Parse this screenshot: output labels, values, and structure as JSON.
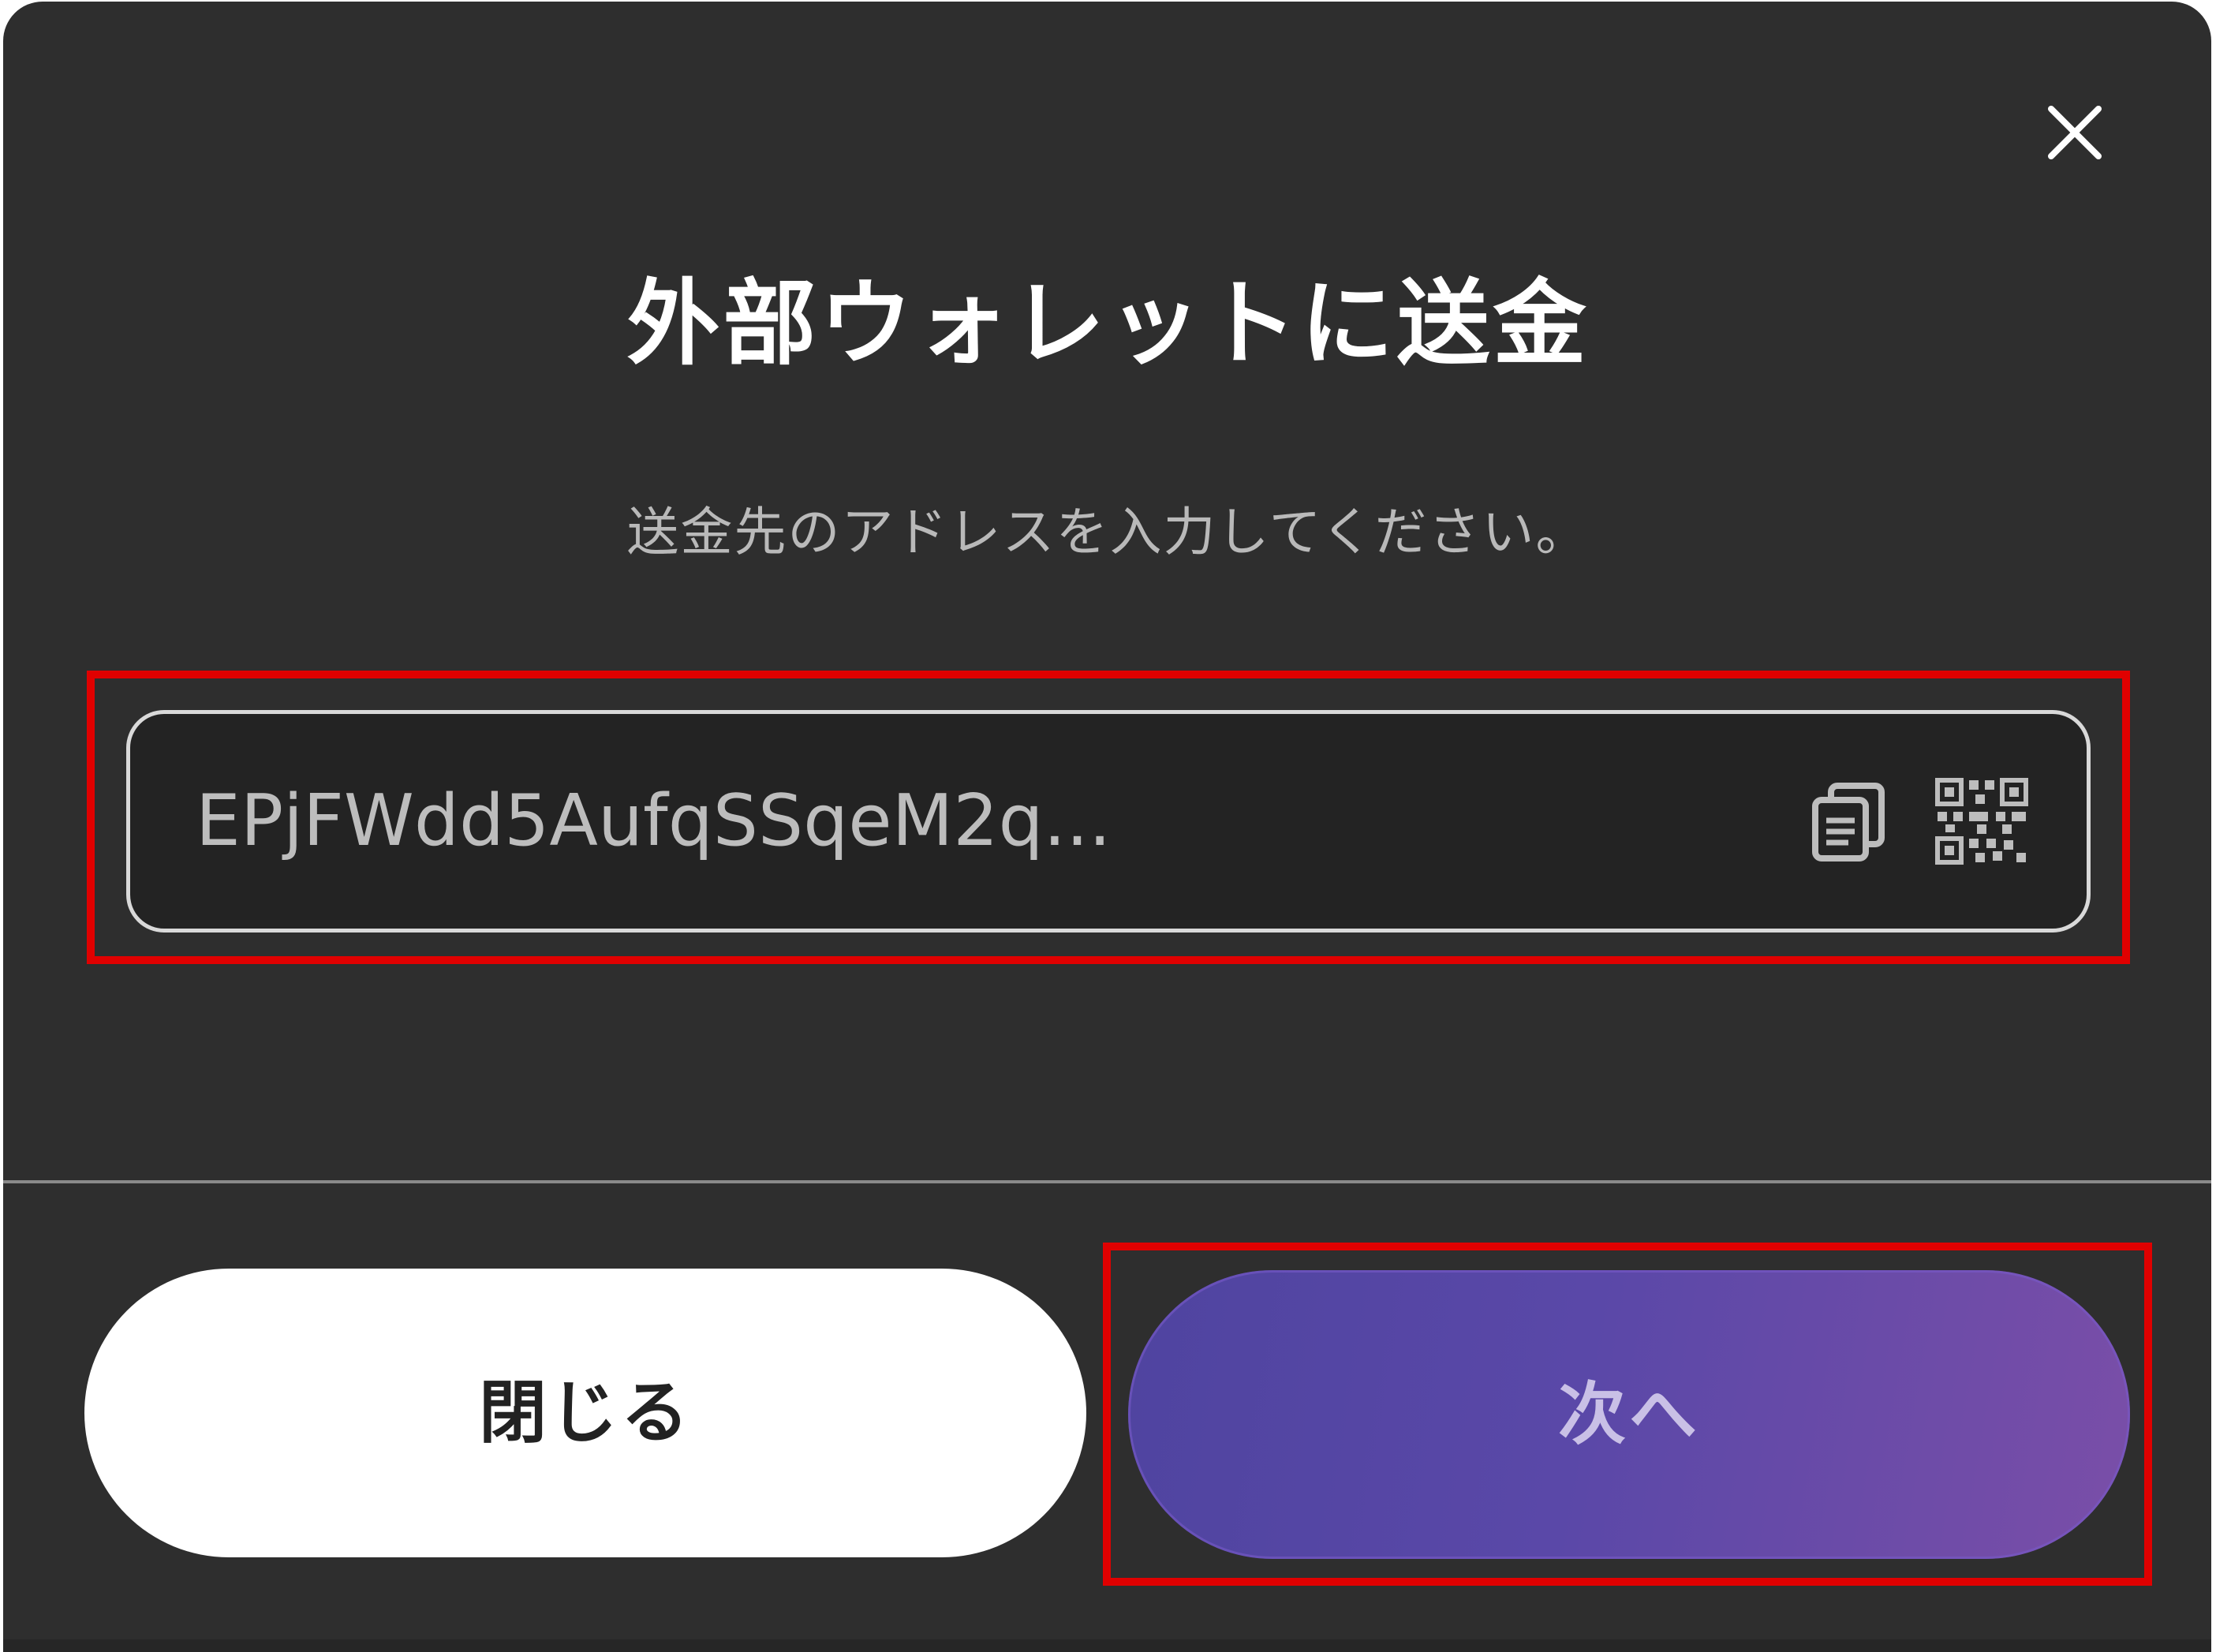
{
  "dialog": {
    "title": "外部ウォレットに送金",
    "instruction": "送金先のアドレスを入力してください。"
  },
  "address_field": {
    "value": "EPjFWdd5AufqSSqeM2q...",
    "paste_icon": "paste-icon",
    "qr_icon": "qr-code-icon"
  },
  "buttons": {
    "close_label": "閉じる",
    "next_label": "次へ"
  },
  "icons": {
    "close": "close-icon"
  },
  "colors": {
    "background": "#2e2e2e",
    "field_border": "#d9d9d9",
    "next_button_start": "#4f44a0",
    "next_button_end": "#7a4ea8",
    "highlight": "#e00000"
  }
}
